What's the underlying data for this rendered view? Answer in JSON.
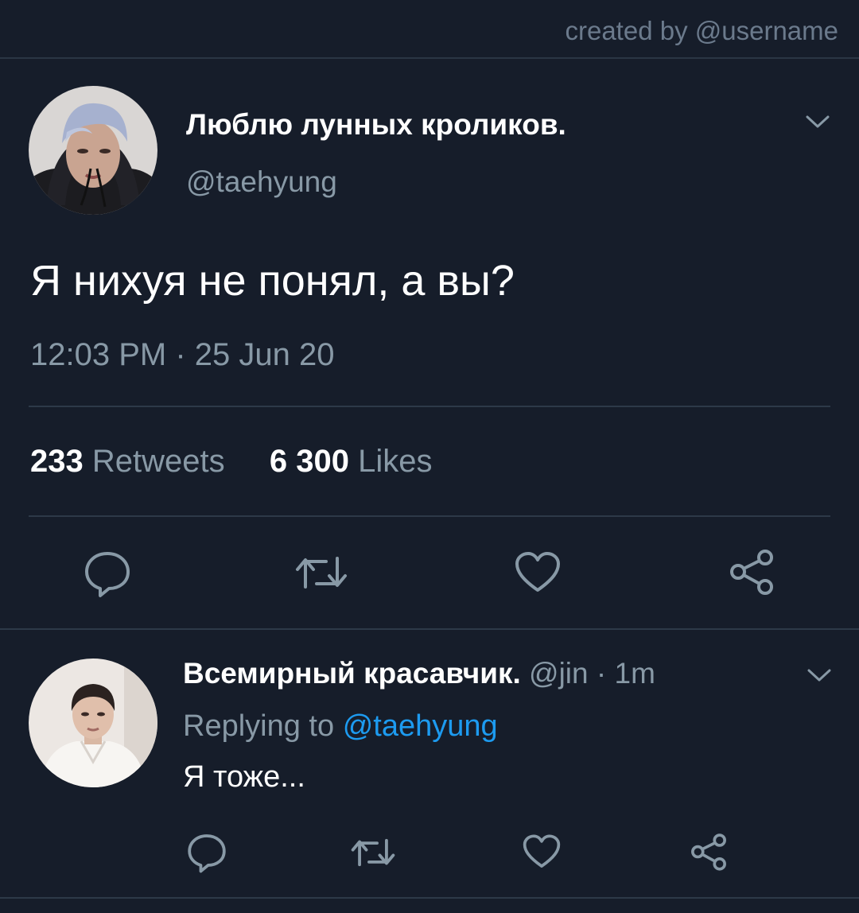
{
  "watermark": "created by @username",
  "tweet": {
    "display_name": "Люблю лунных кроликов.",
    "handle": "@taehyung",
    "text": "Я нихуя не понял, а вы?",
    "timestamp": "12:03 PM · 25 Jun 20",
    "retweets_count": "233",
    "retweets_label": "Retweets",
    "likes_count": "6 300",
    "likes_label": "Likes",
    "avatar": "profile-photo-gray-hair"
  },
  "reply": {
    "display_name": "Всемирный красавчик.",
    "meta": "@jin · 1m",
    "replying_prefix": "Replying to",
    "replying_mention": "@taehyung",
    "text": "Я тоже...",
    "avatar": "profile-photo-white-shirt"
  },
  "icons": {
    "reply": "speech-bubble-icon",
    "retweet": "retweet-arrows-icon",
    "like": "heart-icon",
    "share": "share-nodes-icon",
    "menu": "chevron-down-icon"
  },
  "colors": {
    "background": "#161d2a",
    "secondary_text": "#8899a6",
    "mention": "#1d9bf0",
    "divider": "#2d3948"
  }
}
